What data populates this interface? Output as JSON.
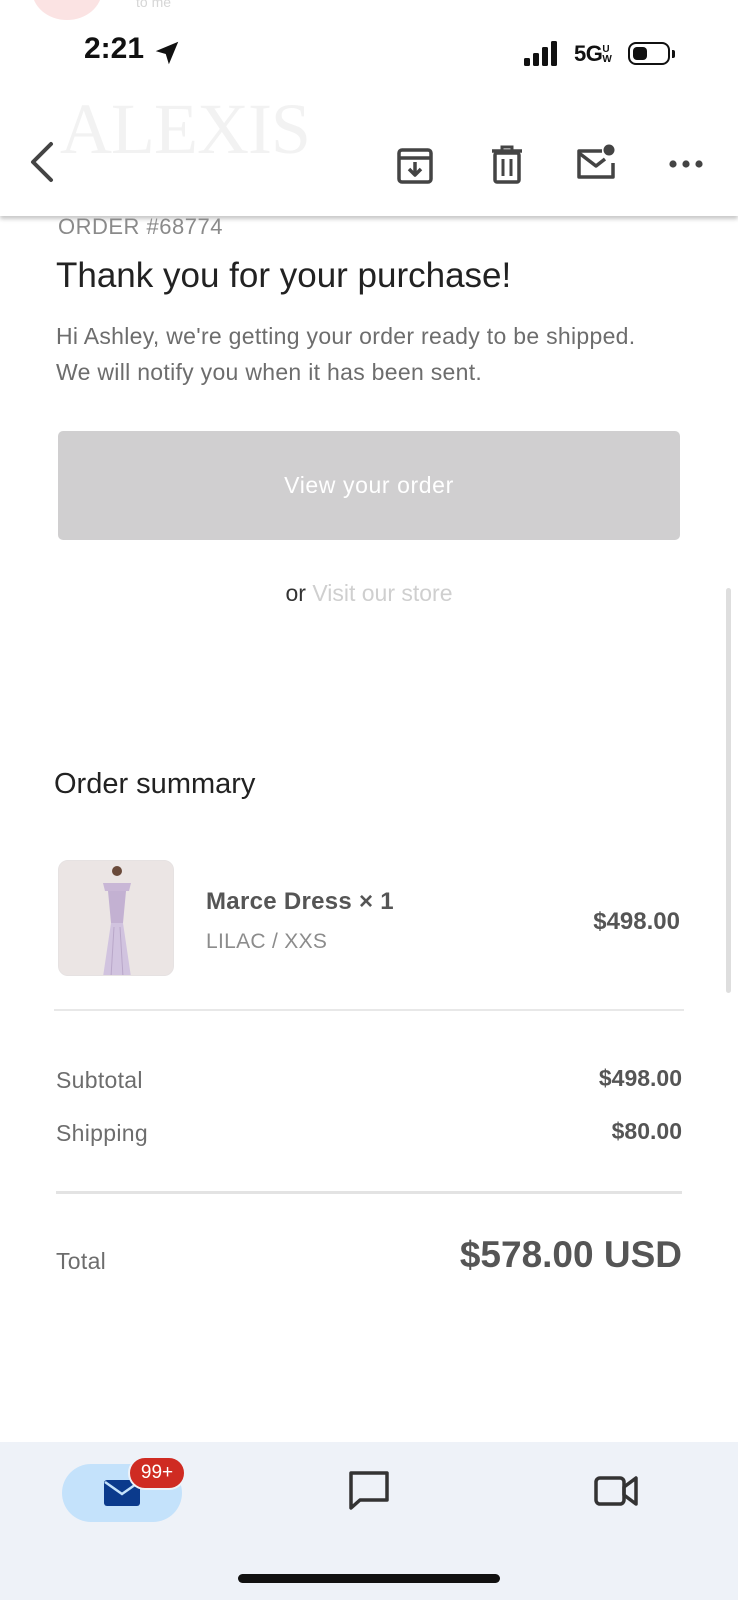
{
  "background": {
    "brand_watermark": "ALEXIS",
    "recipient_line": "to me"
  },
  "status_bar": {
    "time": "2:21",
    "network": "5G",
    "network_suffix": "UW",
    "battery_percent": 45
  },
  "toolbar": {
    "icons": [
      "back-icon",
      "archive-icon",
      "trash-icon",
      "mark-unread-icon",
      "more-icon"
    ]
  },
  "email": {
    "order_number": "ORDER #68774",
    "headline": "Thank you for your purchase!",
    "intro": "Hi Ashley, we're getting your order ready to be shipped. We will notify you when it has been sent.",
    "view_order_label": "View your order",
    "or_text": "or",
    "visit_store_label": "Visit our store",
    "summary_title": "Order summary",
    "items": [
      {
        "name": "Marce Dress × 1",
        "variant": "LILAC / XXS",
        "price": "$498.00"
      }
    ],
    "subtotal_label": "Subtotal",
    "subtotal_value": "$498.00",
    "shipping_label": "Shipping",
    "shipping_value": "$80.00",
    "total_label": "Total",
    "total_value": "$578.00 USD",
    "cut_off_text": "...  ...  ..  ."
  },
  "bottom_nav": {
    "mail_badge": "99+",
    "items": [
      "mail-icon",
      "chat-icon",
      "video-icon"
    ]
  },
  "colors": {
    "button_bg": "#d0cfd0",
    "badge_red": "#cf2b22",
    "nav_bg": "#eef2f8",
    "mail_pill": "#c4e2fb",
    "mail_icon": "#0b3a8c"
  }
}
